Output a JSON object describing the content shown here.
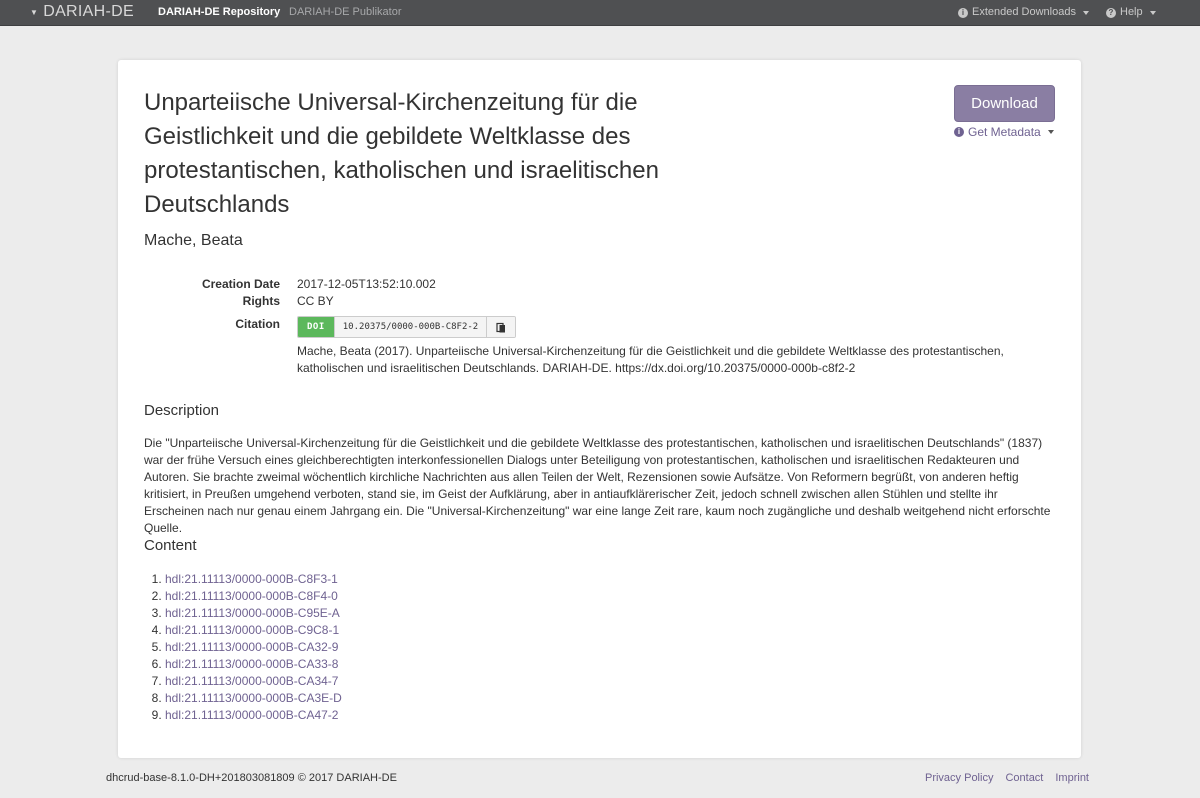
{
  "navbar": {
    "brand": "DARIAH-DE",
    "links": [
      "DARIAH-DE Repository",
      "DARIAH-DE Publikator"
    ],
    "extended_downloads": "Extended Downloads",
    "help": "Help"
  },
  "record": {
    "title": "Unparteiische Universal-Kirchenzeitung für die Geistlichkeit und die gebildete Weltklasse des protestantischen, katholischen und israelitischen Deutschlands",
    "author": "Mache, Beata",
    "download_label": "Download",
    "get_metadata_label": "Get Metadata"
  },
  "metadata": {
    "creation_date_label": "Creation Date",
    "creation_date": "2017-12-05T13:52:10.002",
    "rights_label": "Rights",
    "rights": "CC BY",
    "citation_label": "Citation",
    "doi_tag": "DOI",
    "doi": "10.20375/0000-000B-C8F2-2",
    "citation_text": "Mache, Beata (2017). Unparteiische Universal-Kirchenzeitung für die Geistlichkeit und die gebildete Weltklasse des protestantischen, katholischen und israelitischen Deutschlands. DARIAH-DE. https://dx.doi.org/10.20375/0000-000b-c8f2-2"
  },
  "description": {
    "heading": "Description",
    "text": "Die \"Unparteiische Universal-Kirchenzeitung für die Geistlichkeit und die gebildete Weltklasse des protestantischen, katholischen und israelitischen Deutschlands\" (1837) war der frühe Versuch eines gleichberechtigten interkonfessionellen Dialogs unter Beteiligung von protestantischen, katholischen und israelitischen Redakteuren und Autoren. Sie brachte zweimal wöchentlich kirchliche Nachrichten aus allen Teilen der Welt, Rezensionen sowie Aufsätze. Von Reformern begrüßt, von anderen heftig kritisiert, in Preußen umgehend verboten, stand sie, im Geist der Aufklärung, aber in antiaufklärerischer Zeit, jedoch schnell zwischen allen Stühlen und stellte ihr Erscheinen nach nur genau einem Jahrgang ein. Die \"Universal-Kirchenzeitung\" war eine lange Zeit rare, kaum noch zugängliche und deshalb weitgehend nicht erforschte Quelle."
  },
  "content": {
    "heading": "Content",
    "items": [
      "hdl:21.11113/0000-000B-C8F3-1",
      "hdl:21.11113/0000-000B-C8F4-0",
      "hdl:21.11113/0000-000B-C95E-A",
      "hdl:21.11113/0000-000B-C9C8-1",
      "hdl:21.11113/0000-000B-CA32-9",
      "hdl:21.11113/0000-000B-CA33-8",
      "hdl:21.11113/0000-000B-CA34-7",
      "hdl:21.11113/0000-000B-CA3E-D",
      "hdl:21.11113/0000-000B-CA47-2"
    ]
  },
  "footer": {
    "version": "dhcrud-base-8.1.0-DH+201803081809 © 2017 DARIAH-DE",
    "links": [
      "Privacy Policy",
      "Contact",
      "Imprint"
    ]
  },
  "colors": {
    "navbar_bg": "#4f5052",
    "accent": "#8a7ea3",
    "link": "#6f6291",
    "doi_green": "#5cb85c",
    "page_bg": "#ececec"
  }
}
